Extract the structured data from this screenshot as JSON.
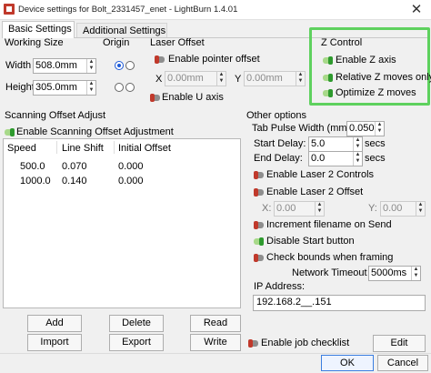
{
  "window": {
    "title": "Device settings for Bolt_2331457_enet - LightBurn 1.4.01",
    "close_glyph": "✕"
  },
  "tabs": [
    {
      "label": "Basic Settings",
      "active": true
    },
    {
      "label": "Additional Settings",
      "active": false
    }
  ],
  "working_size": {
    "title": "Working Size",
    "width_label": "Width",
    "width_value": "508.0mm",
    "height_label": "Height",
    "height_value": "305.0mm"
  },
  "origin": {
    "title": "Origin",
    "selected": "top-left"
  },
  "laser_offset": {
    "title": "Laser Offset",
    "enable_pointer_offset_label": "Enable pointer offset",
    "enable_pointer_offset": false,
    "x_label": "X",
    "x_value": "0.00mm",
    "y_label": "Y",
    "y_value": "0.00mm",
    "enable_u_axis_label": "Enable U axis",
    "enable_u_axis": false
  },
  "z_control": {
    "title": "Z Control",
    "enable_z_axis_label": "Enable Z axis",
    "enable_z_axis": true,
    "relative_z_moves_label": "Relative Z moves only",
    "relative_z_moves": true,
    "optimize_z_moves_label": "Optimize Z moves",
    "optimize_z_moves": true
  },
  "scanning_offset": {
    "title": "Scanning Offset Adjust",
    "enable_label": "Enable Scanning Offset Adjustment",
    "enabled": true,
    "columns": [
      "Speed",
      "Line Shift",
      "Initial Offset"
    ],
    "rows": [
      [
        "500.0",
        "0.070",
        "0.000"
      ],
      [
        "1000.0",
        "0.140",
        "0.000"
      ]
    ],
    "buttons": {
      "add": "Add",
      "delete": "Delete",
      "read": "Read",
      "import": "Import",
      "export": "Export",
      "write": "Write"
    }
  },
  "other_options": {
    "title": "Other options",
    "tab_pulse_width_label": "Tab Pulse Width (mm)",
    "tab_pulse_width_value": "0.050",
    "start_delay_label": "Start Delay:",
    "start_delay_value": "5.0",
    "start_delay_unit": "secs",
    "end_delay_label": "End Delay:",
    "end_delay_value": "0.0",
    "end_delay_unit": "secs",
    "enable_laser2_controls_label": "Enable Laser 2 Controls",
    "enable_laser2_controls": false,
    "enable_laser2_offset_label": "Enable Laser 2 Offset",
    "enable_laser2_offset": false,
    "laser2_x_label": "X:",
    "laser2_x_value": "0.00",
    "laser2_y_label": "Y:",
    "laser2_y_value": "0.00",
    "increment_filename_label": "Increment filename on Send",
    "increment_filename": false,
    "disable_start_button_label": "Disable Start button",
    "disable_start_button": true,
    "check_bounds_label": "Check bounds when framing",
    "check_bounds": false,
    "network_timeout_label": "Network Timeout",
    "network_timeout_value": "5000ms",
    "ip_address_label": "IP Address:",
    "ip_address_value": "192.168.2__.151"
  },
  "footer": {
    "enable_job_checklist_label": "Enable job checklist",
    "enable_job_checklist": false,
    "edit_label": "Edit",
    "ok_label": "OK",
    "cancel_label": "Cancel"
  },
  "colors": {
    "highlight": "#5ed15e",
    "toggle_on": "#2e9a2e",
    "toggle_off": "#c0392b",
    "radio_selected": "#1e5bd8"
  }
}
